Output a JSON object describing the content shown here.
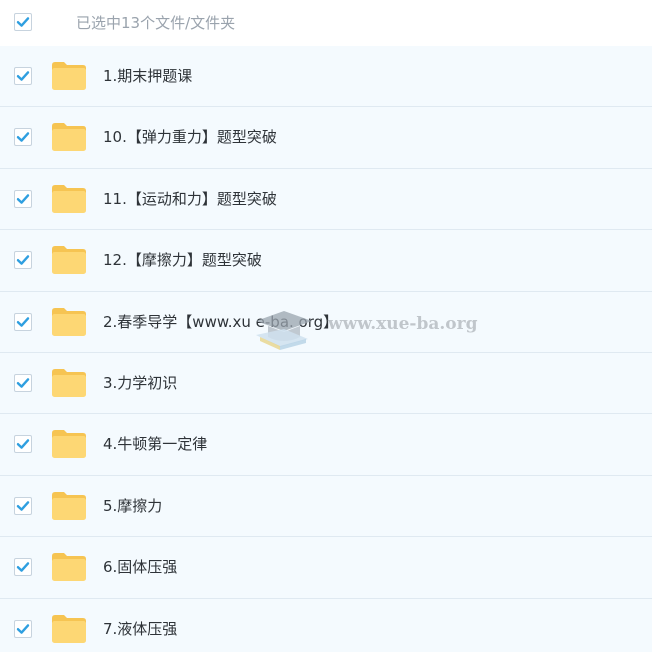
{
  "header": {
    "selected_text": "已选中13个文件/文件夹",
    "checked": true
  },
  "items": [
    {
      "name": "1.期末押题课",
      "checked": true
    },
    {
      "name": "10.【弹力重力】题型突破",
      "checked": true
    },
    {
      "name": "11.【运动和力】题型突破",
      "checked": true
    },
    {
      "name": "12.【摩擦力】题型突破",
      "checked": true
    },
    {
      "name": "2.春季导学【www.xu e-ba. org】",
      "checked": true
    },
    {
      "name": "3.力学初识",
      "checked": true
    },
    {
      "name": "4.牛顿第一定律",
      "checked": true
    },
    {
      "name": "5.摩擦力",
      "checked": true
    },
    {
      "name": "6.固体压强",
      "checked": true
    },
    {
      "name": "7.液体压强",
      "checked": true
    }
  ],
  "watermark": {
    "text": "www.xue-ba.org"
  },
  "colors": {
    "check": "#2f9fe0",
    "folder": "#fdd774",
    "folder_tab": "#f6c452",
    "row_bg": "#f4fafe",
    "divider": "#dfe9f1"
  },
  "icons": {
    "checkbox": "checkmark-icon",
    "folder": "folder-icon",
    "watermark_logo": "graduation-cap-icon"
  }
}
